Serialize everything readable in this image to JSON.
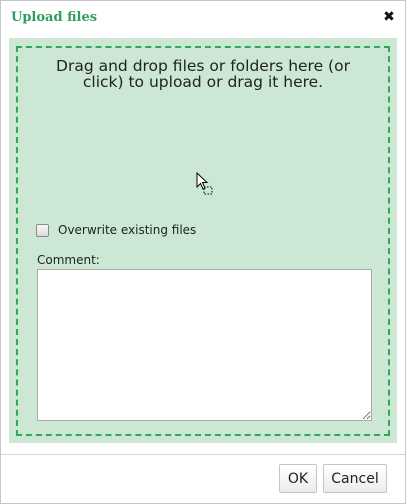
{
  "dialog": {
    "title": "Upload files",
    "close_glyph": "✖"
  },
  "dropzone": {
    "instructions": "Drag and drop files or folders here (or click) to upload or drag it here.",
    "overwrite_label": "Overwrite existing files",
    "overwrite_checked": false,
    "comment_label": "Comment:",
    "comment_value": ""
  },
  "buttons": {
    "ok_label": "OK",
    "cancel_label": "Cancel"
  },
  "colors": {
    "title": "#2e9e5b",
    "dropzone_bg": "#cce8d4",
    "dropzone_border": "#2faa5a"
  },
  "icons": {
    "close": "close-icon",
    "cursor": "copy-cursor-icon",
    "resize": "resize-grip-icon"
  }
}
